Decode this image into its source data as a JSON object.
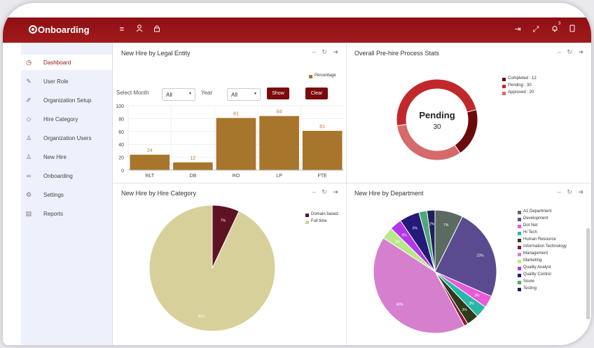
{
  "app": {
    "title": "Onboarding"
  },
  "topbar": {
    "left_icons": [
      "menu-icon",
      "user-icon",
      "lock-icon"
    ],
    "right_icons": [
      "logout-icon",
      "expand-icon",
      "bell-icon",
      "tablet-icon"
    ],
    "notification_count": "3"
  },
  "sidebar": {
    "items": [
      {
        "label": "Dashboard",
        "icon": "clock-icon",
        "active": true
      },
      {
        "label": "User Role",
        "icon": "edit-icon",
        "active": false
      },
      {
        "label": "Organization Setup",
        "icon": "pencil-icon",
        "active": false
      },
      {
        "label": "Hire Category",
        "icon": "tag-icon",
        "active": false
      },
      {
        "label": "Organization Users",
        "icon": "users-icon",
        "active": false
      },
      {
        "label": "New Hire",
        "icon": "user-icon",
        "active": false
      },
      {
        "label": "Onboarding",
        "icon": "link-icon",
        "active": false
      },
      {
        "label": "Settings",
        "icon": "gear-icon",
        "active": false
      },
      {
        "label": "Reports",
        "icon": "report-icon",
        "active": false
      }
    ]
  },
  "panels": {
    "legal_entity": {
      "title": "New Hire by Legal Entity",
      "legend": "Percentage",
      "month_label": "Select Month",
      "month_value": "All",
      "year_label": "Year",
      "year_value": "All",
      "show_label": "Show",
      "clear_label": "Clear"
    },
    "prehire": {
      "title": "Overall Pre-hire Process Stats",
      "center_label": "Pending",
      "center_value": "30",
      "legend": [
        "Completed : 12",
        "Pending : 30",
        "Approved : 20"
      ]
    },
    "hire_category": {
      "title": "New Hire by Hire Category",
      "legend": [
        "Domain based",
        "Full time"
      ]
    },
    "department": {
      "title": "New Hire by Department",
      "legend": [
        "A1 Department",
        "Development",
        "Dot Net",
        "Hi Tech",
        "Human Resource",
        "Information Technology",
        "Management",
        "Marketing",
        "Quality Analyst",
        "Quality Control",
        "Soure",
        "Testing"
      ]
    }
  },
  "chart_data": [
    {
      "type": "bar",
      "title": "New Hire by Legal Entity",
      "categories": [
        "RLT",
        "DB",
        "RO",
        "LP",
        "FTE"
      ],
      "values": [
        24,
        12,
        81,
        84,
        61
      ],
      "series": [
        {
          "name": "Percentage",
          "values": [
            24,
            12,
            81,
            84,
            61
          ]
        }
      ],
      "ylim": [
        0,
        100
      ],
      "yticks": [
        0,
        20,
        40,
        60,
        80,
        100
      ],
      "color": "#a8752c"
    },
    {
      "type": "pie",
      "title": "Overall Pre-hire Process Stats",
      "donut": true,
      "categories": [
        "Completed",
        "Pending",
        "Approved"
      ],
      "values": [
        12,
        30,
        20
      ],
      "colors": [
        "#6b0a0d",
        "#c0282c",
        "#d66a6a"
      ]
    },
    {
      "type": "pie",
      "title": "New Hire by Hire Category",
      "categories": [
        "Domain based",
        "Full time"
      ],
      "values": [
        7,
        93
      ],
      "labels": [
        "7%",
        "93%"
      ],
      "colors": [
        "#5e1325",
        "#d8d09a"
      ]
    },
    {
      "type": "pie",
      "title": "New Hire by Department",
      "categories": [
        "A1 Department",
        "Development",
        "Dot Net",
        "Hi Tech",
        "Human Resource",
        "Information Technology",
        "Management",
        "Marketing",
        "Quality Analyst",
        "Quality Control",
        "Soure",
        "Testing"
      ],
      "values": [
        7,
        23,
        3,
        3,
        3,
        1,
        40,
        3,
        3,
        5,
        2,
        2
      ],
      "labels": [
        "7%",
        "23%",
        "3%",
        "3%",
        "3%",
        "",
        "40%",
        "3%",
        "3%",
        "5%",
        "",
        "2%"
      ],
      "colors": [
        "#5b6b62",
        "#5a4a8f",
        "#e85ad8",
        "#27b8a8",
        "#2e3b1a",
        "#8c1a3a",
        "#d77fcf",
        "#b9e88b",
        "#b238e8",
        "#241a7a",
        "#4ea878",
        "#1f1f5f"
      ]
    }
  ]
}
